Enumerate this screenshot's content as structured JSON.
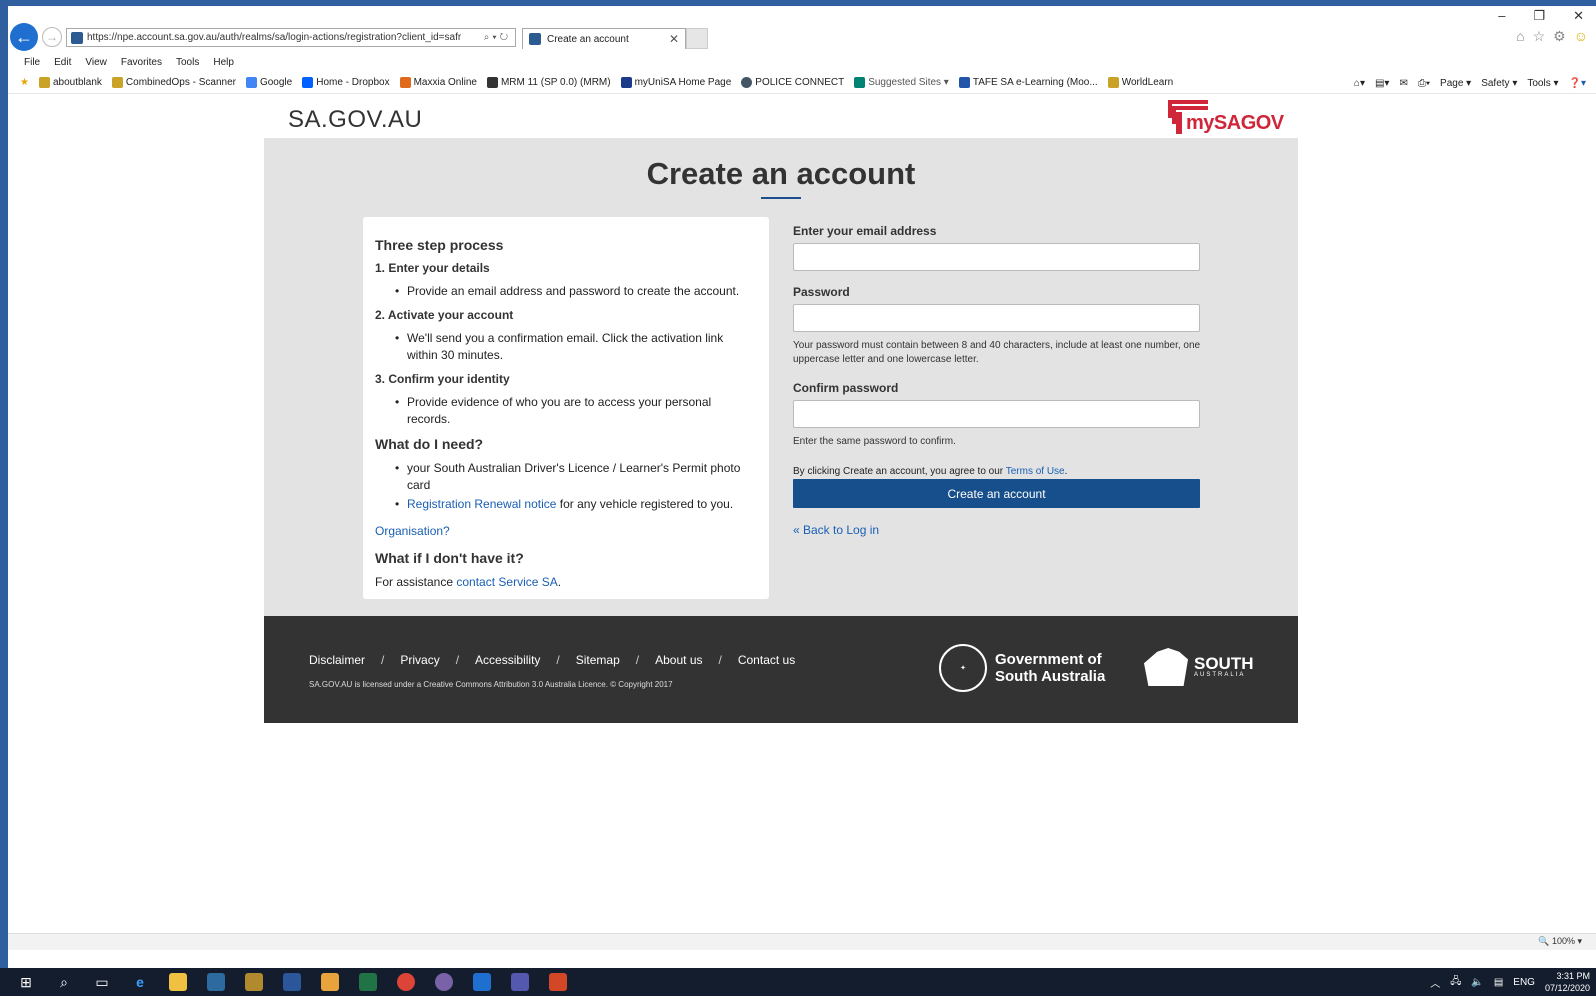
{
  "browser": {
    "url": "https://npe.account.sa.gov.au/auth/realms/sa/login-actions/registration?client_id=safr",
    "tab_title": "Create an account",
    "menu": [
      "File",
      "Edit",
      "View",
      "Favorites",
      "Tools",
      "Help"
    ],
    "favorites": [
      {
        "label": "aboutblank",
        "color": "#c9a227"
      },
      {
        "label": "CombinedOps - Scanner",
        "color": "#c9a227"
      },
      {
        "label": "Google",
        "color": "#4285f4"
      },
      {
        "label": "Home - Dropbox",
        "color": "#0061fe"
      },
      {
        "label": "Maxxia Online",
        "color": "#e06a1b"
      },
      {
        "label": "MRM 11 (SP 0.0) (MRM)",
        "color": "#333333"
      },
      {
        "label": "myUniSA Home Page",
        "color": "#1b3a8a"
      },
      {
        "label": "POLICE CONNECT",
        "color": "#445566"
      },
      {
        "label": "Suggested Sites ▾",
        "color": "#008272"
      },
      {
        "label": "TAFE SA e-Learning (Moo...",
        "color": "#2255aa"
      },
      {
        "label": "WorldLearn",
        "color": "#c9a227"
      }
    ],
    "commands": [
      "Page ▾",
      "Safety ▾",
      "Tools ▾"
    ],
    "zoom": "100%"
  },
  "site": {
    "logo": "SA.GOV.AU",
    "brand_my": "my",
    "brand_sagov": "SAGOV"
  },
  "page": {
    "title": "Create an account",
    "info": {
      "heading": "Three step process",
      "step1": "1. Enter your details",
      "step1_bullet": "Provide an email address and password to create the account.",
      "step2": "2. Activate your account",
      "step2_bullet": "We'll send you a confirmation email. Click the activation link within 30 minutes.",
      "step3": "3. Confirm your identity",
      "step3_bullet": "Provide evidence of who you are to access your personal records.",
      "need_heading": "What do I need?",
      "need_1": "your South Australian Driver's Licence / Learner's Permit photo card",
      "need_2_link": "Registration Renewal notice",
      "need_2_rest": " for any vehicle registered to you.",
      "organisation_link": "Organisation?",
      "dont_have_heading": "What if I don't have it?",
      "assist_prefix": "For assistance ",
      "assist_link": "contact Service SA",
      "assist_suffix": "."
    },
    "form": {
      "email_label": "Enter your email address",
      "email_value": "",
      "password_label": "Password",
      "password_value": "",
      "password_hint": "Your password must contain between 8 and 40 characters, include at least one number, one uppercase letter and one lowercase letter.",
      "confirm_label": "Confirm password",
      "confirm_value": "",
      "confirm_hint": "Enter the same password to confirm.",
      "terms_prefix": "By clicking Create an account, you agree to our ",
      "terms_link": "Terms of Use",
      "terms_suffix": ".",
      "submit": "Create an account",
      "back": "« Back to Log in"
    }
  },
  "footer": {
    "links": [
      "Disclaimer",
      "Privacy",
      "Accessibility",
      "Sitemap",
      "About us",
      "Contact us"
    ],
    "licence": "SA.GOV.AU is licensed under a Creative Commons Attribution 3.0 Australia Licence. © Copyright 2017",
    "gov_line1": "Government of",
    "gov_line2": "South Australia",
    "south": "SOUTH",
    "australia": "AUSTRALIA"
  },
  "taskbar": {
    "lang": "ENG",
    "time": "3:31 PM",
    "date": "07/12/2020"
  }
}
